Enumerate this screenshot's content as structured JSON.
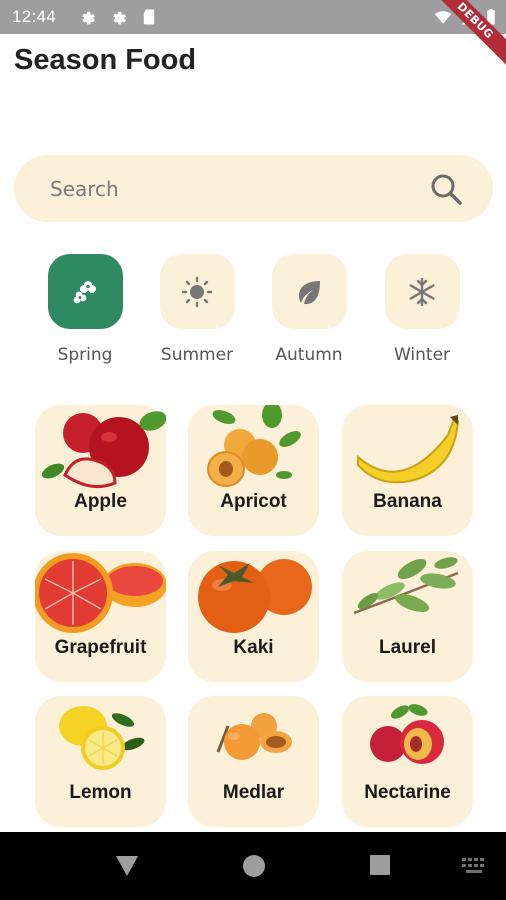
{
  "status_bar": {
    "time": "12:44",
    "debug_label": "DEBUG"
  },
  "app": {
    "title": "Season Food"
  },
  "search": {
    "placeholder": "Search"
  },
  "seasons": [
    {
      "label": "Spring",
      "icon": "flower-icon",
      "active": true
    },
    {
      "label": "Summer",
      "icon": "sun-icon",
      "active": false
    },
    {
      "label": "Autumn",
      "icon": "leaf-icon",
      "active": false
    },
    {
      "label": "Winter",
      "icon": "snowflake-icon",
      "active": false
    }
  ],
  "foods": [
    {
      "label": "Apple"
    },
    {
      "label": "Apricot"
    },
    {
      "label": "Banana"
    },
    {
      "label": "Grapefruit"
    },
    {
      "label": "Kaki"
    },
    {
      "label": "Laurel"
    },
    {
      "label": "Lemon"
    },
    {
      "label": "Medlar"
    },
    {
      "label": "Nectarine"
    }
  ],
  "colors": {
    "accent": "#2f8a64",
    "card_bg": "#fdf0d8",
    "status_bar": "#9e9e9e",
    "debug_ribbon": "#b22d38"
  }
}
